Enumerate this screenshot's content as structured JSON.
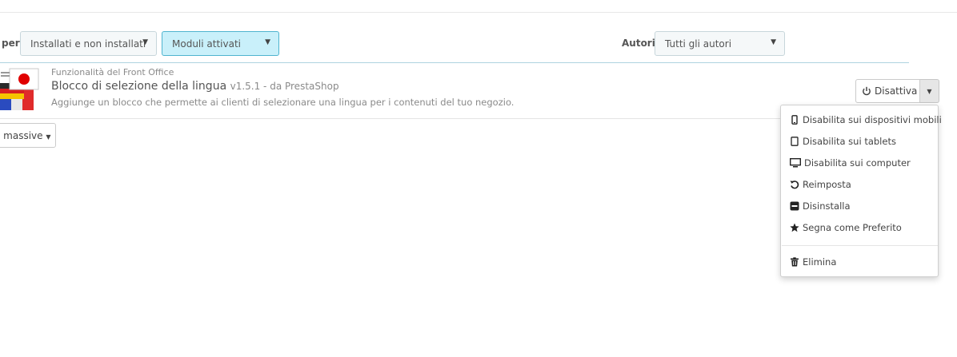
{
  "filters": {
    "by_label": "per",
    "install_filter": "Installati e non installati",
    "status_filter": "Moduli attivati",
    "authors_label": "Autori",
    "authors_filter": "Tutti gli autori"
  },
  "module": {
    "category": "Funzionalità del Front Office",
    "name": "Blocco di selezione della lingua",
    "version": "v1.5.1 - da PrestaShop",
    "description": "Aggiunge un blocco che permette ai clienti di selezionare una lingua per i contenuti del tuo negozio.",
    "logo_icon": "language-flags-icon",
    "action_label": "Disattiva"
  },
  "dropdown": {
    "items": [
      {
        "label": "Disabilita sui dispositivi mobili",
        "icon": "mobile-icon"
      },
      {
        "label": "Disabilita sui tablets",
        "icon": "tablet-icon"
      },
      {
        "label": "Disabilita sui computer",
        "icon": "desktop-icon"
      },
      {
        "label": "Reimposta",
        "icon": "undo-icon"
      },
      {
        "label": "Disinstalla",
        "icon": "minus-square-icon"
      },
      {
        "label": "Segna come Preferito",
        "icon": "star-icon"
      },
      {
        "label": "Elimina",
        "icon": "trash-icon"
      }
    ]
  },
  "bulk": {
    "label": "i massive"
  },
  "colors": {
    "active_filter_bg": "#c9f0fa",
    "active_filter_border": "#4fb4cf",
    "divider": "#aed3e0"
  }
}
